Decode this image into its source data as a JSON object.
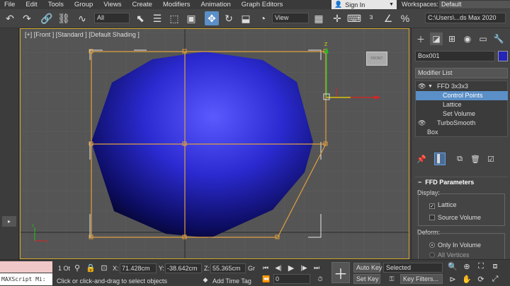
{
  "menu": {
    "items": [
      "File",
      "Edit",
      "Tools",
      "Group",
      "Views",
      "Create",
      "Modifiers",
      "Animation",
      "Graph Editors"
    ],
    "sign_in": "Sign In",
    "workspaces_label": "Workspaces:",
    "workspaces_value": "Default"
  },
  "toolbar": {
    "selection_filter": "All",
    "reference_coord": "View",
    "project_path": "C:\\Users\\...ds Max 2020"
  },
  "viewport": {
    "label": "[+] [Front ] [Standard ] [Default Shading ]",
    "viewcube_label": "FRONT"
  },
  "panel": {
    "object_name": "Box001",
    "object_color": "#2424b8",
    "modifier_list_label": "Modifier List",
    "stack": [
      {
        "label": "FFD 3x3x3",
        "eye": "👁",
        "arrow": "▼"
      },
      {
        "label": "Control Points"
      },
      {
        "label": "Lattice"
      },
      {
        "label": "Set Volume"
      },
      {
        "label": "TurboSmooth",
        "eye": "👁"
      },
      {
        "label": "Box"
      }
    ],
    "rollout_title": "FFD Parameters",
    "display_label": "Display:",
    "lattice_label": "Lattice",
    "lattice_checked": true,
    "source_volume_label": "Source Volume",
    "deform_label": "Deform:",
    "only_in_volume_label": "Only In Volume",
    "all_vertices_label": "All Vertices"
  },
  "status": {
    "maxscript_label": "MAXScript Mi:",
    "selected_count": "1 Ot",
    "x_label": "X:",
    "x_value": "71.428cm",
    "y_label": "Y:",
    "y_value": "-38.642cm",
    "z_label": "Z:",
    "z_value": "55.365cm",
    "grid_label": "Gr",
    "prompt": "Click or click-and-drag to select objects",
    "add_time_tag": "Add Time Tag",
    "frame_value": "0",
    "auto_key": "Auto Key",
    "set_key": "Set Key",
    "key_mode": "Selected",
    "key_filters": "Key Filters..."
  }
}
